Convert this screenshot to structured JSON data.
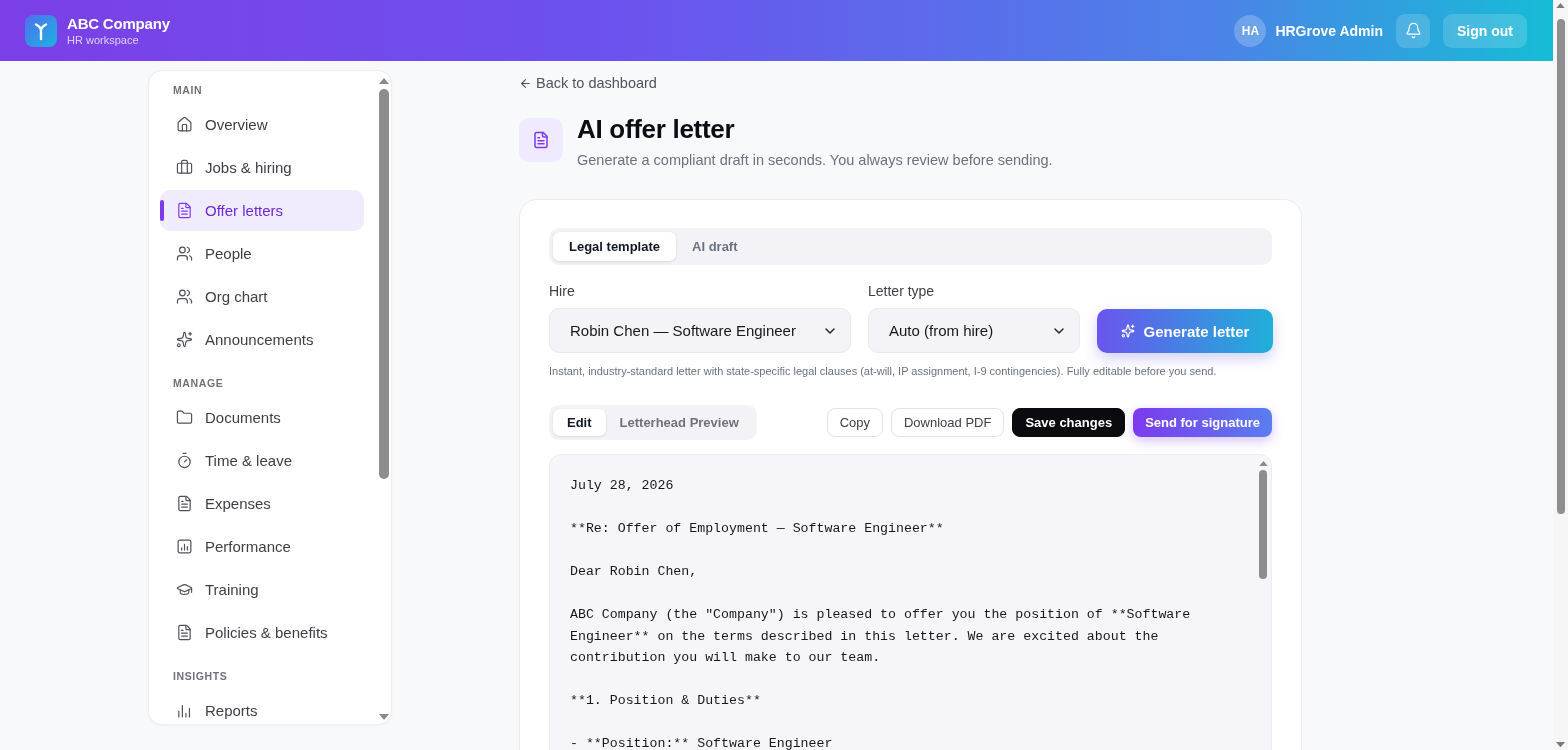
{
  "header": {
    "brand": {
      "name": "ABC Company",
      "subtitle": "HR workspace"
    },
    "user": {
      "initials": "HA",
      "name": "HRGrove Admin"
    },
    "sign_out": "Sign out"
  },
  "sidebar": {
    "sections": [
      {
        "label": "MAIN",
        "items": [
          {
            "label": "Overview",
            "selected": false
          },
          {
            "label": "Jobs & hiring",
            "selected": false
          },
          {
            "label": "Offer letters",
            "selected": true
          },
          {
            "label": "People",
            "selected": false
          },
          {
            "label": "Org chart",
            "selected": false
          },
          {
            "label": "Announcements",
            "selected": false
          }
        ]
      },
      {
        "label": "MANAGE",
        "items": [
          {
            "label": "Documents",
            "selected": false
          },
          {
            "label": "Time & leave",
            "selected": false
          },
          {
            "label": "Expenses",
            "selected": false
          },
          {
            "label": "Performance",
            "selected": false
          },
          {
            "label": "Training",
            "selected": false
          },
          {
            "label": "Policies & benefits",
            "selected": false
          }
        ]
      },
      {
        "label": "INSIGHTS",
        "items": [
          {
            "label": "Reports",
            "selected": false
          }
        ]
      }
    ]
  },
  "page": {
    "back_link": "Back to dashboard",
    "title": "AI offer letter",
    "subtitle": "Generate a compliant draft in seconds. You always review before sending."
  },
  "composer": {
    "tabs": [
      {
        "label": "Legal template",
        "selected": true
      },
      {
        "label": "AI draft",
        "selected": false
      }
    ],
    "fields": [
      {
        "label": "Hire",
        "value": "Robin Chen — Software Engineer"
      },
      {
        "label": "Letter type",
        "value": "Auto (from hire)"
      }
    ],
    "generate_button": "Generate letter",
    "help": "Instant, industry-standard letter with state-specific legal clauses (at-will, IP assignment, I-9 contingencies). Fully editable before you send.",
    "view_tabs": [
      {
        "label": "Edit",
        "selected": true
      },
      {
        "label": "Letterhead Preview",
        "selected": false
      }
    ],
    "actions": [
      {
        "label": "Copy",
        "kind": "outline"
      },
      {
        "label": "Download PDF",
        "kind": "outline"
      },
      {
        "label": "Save changes",
        "kind": "dark"
      },
      {
        "label": "Send for signature",
        "kind": "gradient"
      }
    ],
    "letter": [
      "July 28, 2026",
      "**Re: Offer of Employment — Software Engineer**",
      "Dear Robin Chen,",
      "ABC Company (the \"Company\") is pleased to offer you the position of **Software Engineer** on the terms described in this letter. We are excited about the contribution you will make to our team.",
      "**1. Position & Duties**",
      "- **Position:** Software Engineer"
    ]
  }
}
